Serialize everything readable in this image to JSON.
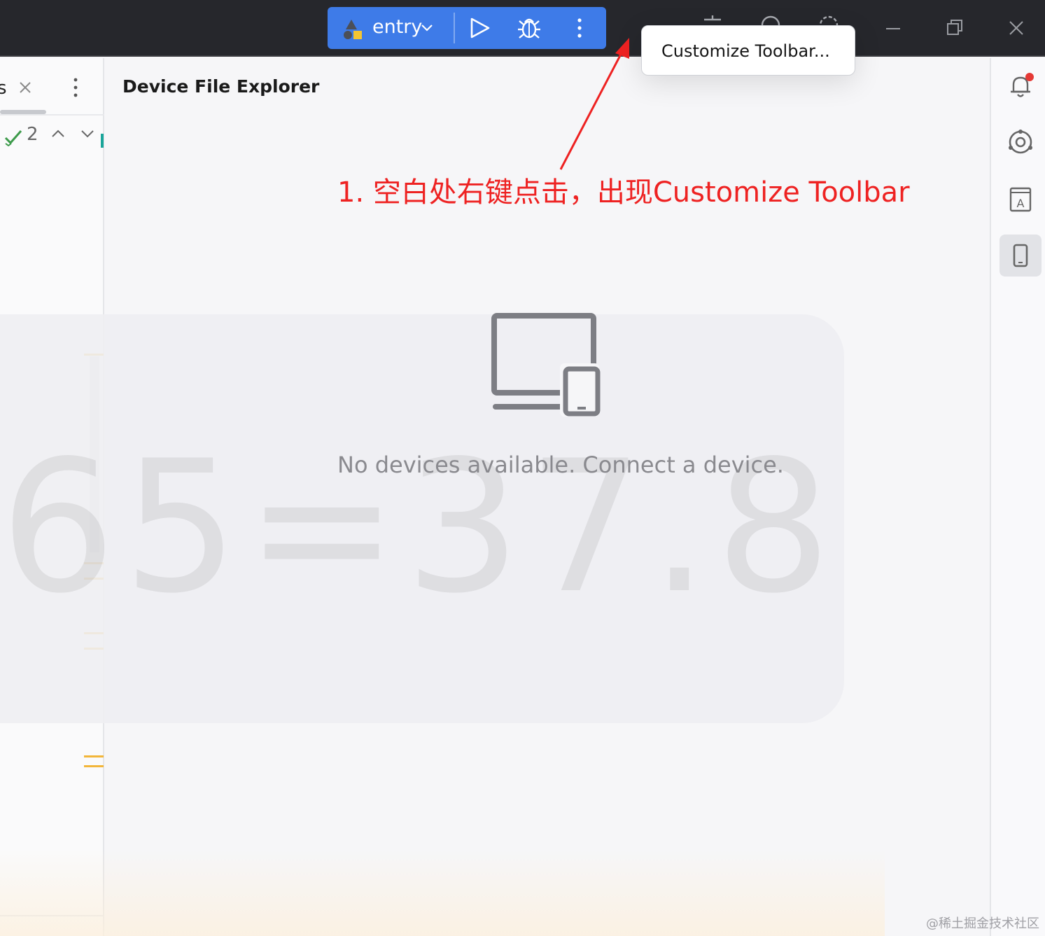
{
  "toolbar": {
    "run_config": "entry",
    "popup_item": "Customize Toolbar..."
  },
  "left_panel": {
    "tab_partial": "s",
    "check_count": "2"
  },
  "main": {
    "title": "Device File Explorer",
    "empty_message": "No devices available. Connect a device.",
    "watermark": "65=37.8"
  },
  "annotation": {
    "text": "1. 空白处右键点击，出现Customize Toolbar"
  },
  "footer": {
    "credit": "@稀土掘金技术社区"
  },
  "colors": {
    "titlebar": "#26272c",
    "accent": "#3e7be8",
    "annotation": "#ee2222",
    "notification_dot": "#e53935"
  }
}
